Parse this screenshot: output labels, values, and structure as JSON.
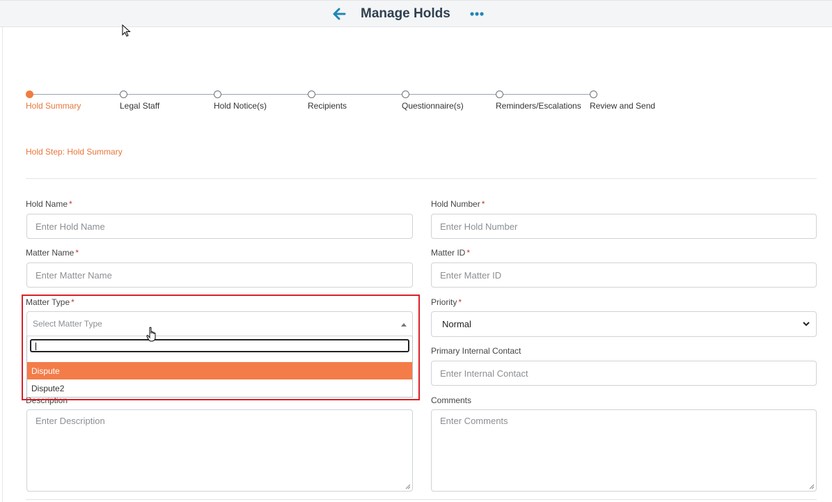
{
  "header": {
    "title": "Manage Holds"
  },
  "stepper": {
    "steps": [
      {
        "label": "Hold Summary",
        "active": true
      },
      {
        "label": "Legal Staff",
        "active": false
      },
      {
        "label": "Hold Notice(s)",
        "active": false
      },
      {
        "label": "Recipients",
        "active": false
      },
      {
        "label": "Questionnaire(s)",
        "active": false
      },
      {
        "label": "Reminders/Escalations",
        "active": false
      },
      {
        "label": "Review and Send",
        "active": false
      }
    ]
  },
  "hold_step": "Hold Step: Hold Summary",
  "form": {
    "hold_name": {
      "label": "Hold Name",
      "placeholder": "Enter Hold Name"
    },
    "hold_number": {
      "label": "Hold Number",
      "placeholder": "Enter Hold Number"
    },
    "matter_name": {
      "label": "Matter Name",
      "placeholder": "Enter Matter Name"
    },
    "matter_id": {
      "label": "Matter ID",
      "placeholder": "Enter Matter ID"
    },
    "matter_type": {
      "label": "Matter Type",
      "placeholder": "Select Matter Type",
      "options": [
        "Dispute",
        "Dispute2"
      ]
    },
    "priority": {
      "label": "Priority",
      "value": "Normal"
    },
    "primary_contact": {
      "label": "Primary Internal Contact",
      "placeholder": "Enter Internal Contact"
    },
    "description": {
      "label": "Description",
      "placeholder": "Enter Description"
    },
    "comments": {
      "label": "Comments",
      "placeholder": "Enter Comments"
    },
    "required_mark": "*"
  },
  "colors": {
    "accent": "#f07c3f",
    "highlight_border": "#d92027",
    "title": "#2f4050",
    "icon_blue": "#1f86b8"
  }
}
